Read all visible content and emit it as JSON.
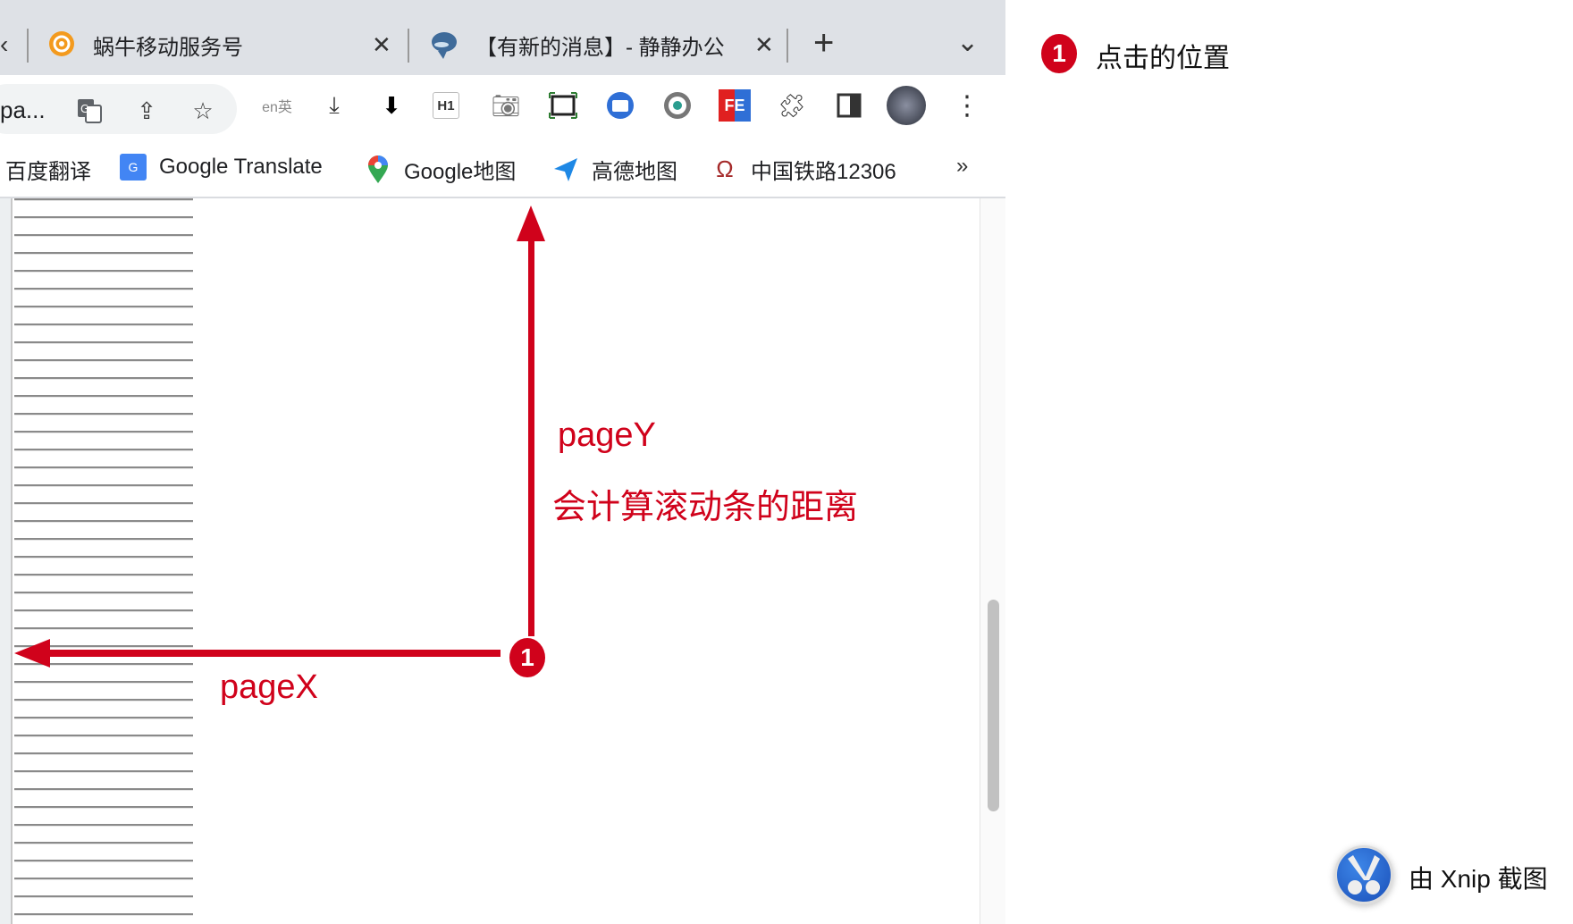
{
  "browser": {
    "tabs": [
      {
        "title": "蜗牛移动服务号",
        "icon": "snail-swirl-icon",
        "close": "✕"
      },
      {
        "title": "【有新的消息】- 静静办公",
        "icon": "whale-icon",
        "close": "✕"
      }
    ],
    "new_tab": "+",
    "tab_menu": "⌄",
    "left_tab_fragment": "‹",
    "omnibox_url": "pa...",
    "toolbar_icons": [
      "translate-icon",
      "share-icon",
      "star-icon",
      "en-translate-icon",
      "download-icon",
      "download-bold-icon",
      "h1-icon",
      "camera-icon",
      "screenshot-icon",
      "chat-extension-icon",
      "eye-icon",
      "fe-icon",
      "extensions-puzzle-icon",
      "sidebar-icon",
      "profile-avatar",
      "more-menu-icon"
    ],
    "h1_label": "H1",
    "fe_label": "FE",
    "bookmarks": [
      {
        "label": "百度翻译",
        "icon": ""
      },
      {
        "label": "Google Translate",
        "icon": "google-translate-icon"
      },
      {
        "label": "Google地图",
        "icon": "google-maps-pin-icon"
      },
      {
        "label": "高德地图",
        "icon": "amap-arrow-icon"
      },
      {
        "label": "中国铁路12306",
        "icon": "railway-logo-icon"
      }
    ],
    "bookmarks_overflow": "»"
  },
  "annotations": {
    "marker_number": "1",
    "page_y_label": "pageY",
    "page_y_note": "会计算滚动条的距离",
    "page_x_label": "pageX",
    "color": "#d0021b"
  },
  "legend": {
    "number": "1",
    "text": "点击的位置"
  },
  "watermark": {
    "text": "由 Xnip 截图",
    "icon": "xnip-scissors-icon"
  }
}
